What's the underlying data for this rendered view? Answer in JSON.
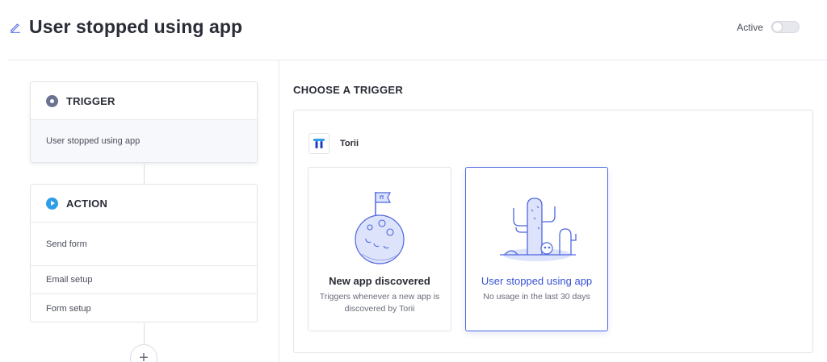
{
  "header": {
    "title": "User stopped using app",
    "active_label": "Active",
    "active": false
  },
  "workflow": {
    "trigger": {
      "title": "TRIGGER",
      "selected": "User stopped using app"
    },
    "action": {
      "title": "ACTION",
      "items": [
        "Send form",
        "Email setup",
        "Form setup"
      ]
    },
    "add_step_label": "+"
  },
  "chooser": {
    "title": "CHOOSE A TRIGGER",
    "provider": "Torii",
    "cards": [
      {
        "title": "New app discovered",
        "description": "Triggers whenever a new app is discovered by Torii",
        "icon": "moon-flag-icon"
      },
      {
        "title": "User stopped using app",
        "description": "No usage in the last 30 days",
        "icon": "cactus-desert-icon",
        "selected": true
      }
    ]
  },
  "colors": {
    "accent": "#3752d6",
    "selected_border": "#4f68e0",
    "illustration_fill": "#dde3fb",
    "illustration_stroke": "#4d66e0",
    "action_dot": "#2f9ee8",
    "trigger_dot": "#6a7390"
  }
}
